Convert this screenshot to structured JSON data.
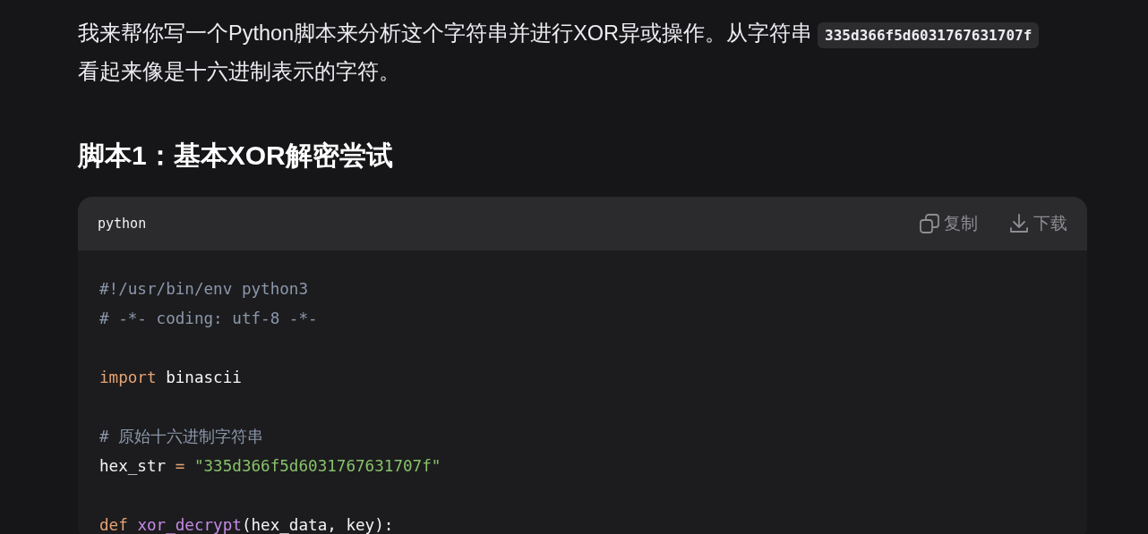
{
  "intro": {
    "text_before": "我来帮你写一个Python脚本来分析这个字符串并进行XOR异或操作。从字符串",
    "inline_code": "335d366f5d6031767631707f",
    "text_after": "看起来像是十六进制表示的字符。"
  },
  "heading": "脚本1：基本XOR解密尝试",
  "code_block": {
    "language": "python",
    "actions": [
      {
        "kind": "copy",
        "label": "复制"
      },
      {
        "kind": "download",
        "label": "下载"
      }
    ],
    "lines": [
      {
        "kind": "code",
        "tokens": [
          {
            "kind": "comment",
            "text": "#!/usr/bin/env python3"
          }
        ]
      },
      {
        "kind": "code",
        "tokens": [
          {
            "kind": "comment",
            "text": "# -*- coding: utf-8 -*-"
          }
        ]
      },
      {
        "kind": "blank"
      },
      {
        "kind": "code",
        "tokens": [
          {
            "kind": "keyword",
            "text": "import"
          },
          {
            "kind": "plain",
            "text": " binascii"
          }
        ]
      },
      {
        "kind": "blank"
      },
      {
        "kind": "code",
        "tokens": [
          {
            "kind": "comment",
            "text": "# 原始十六进制字符串"
          }
        ]
      },
      {
        "kind": "code",
        "tokens": [
          {
            "kind": "plain",
            "text": "hex_str "
          },
          {
            "kind": "operator",
            "text": "= "
          },
          {
            "kind": "string",
            "text": "\"335d366f5d6031767631707f\""
          }
        ]
      },
      {
        "kind": "blank"
      },
      {
        "kind": "code",
        "tokens": [
          {
            "kind": "keyword",
            "text": "def "
          },
          {
            "kind": "function",
            "text": "xor_decrypt"
          },
          {
            "kind": "plain",
            "text": "(hex_data, key):"
          }
        ]
      }
    ]
  }
}
